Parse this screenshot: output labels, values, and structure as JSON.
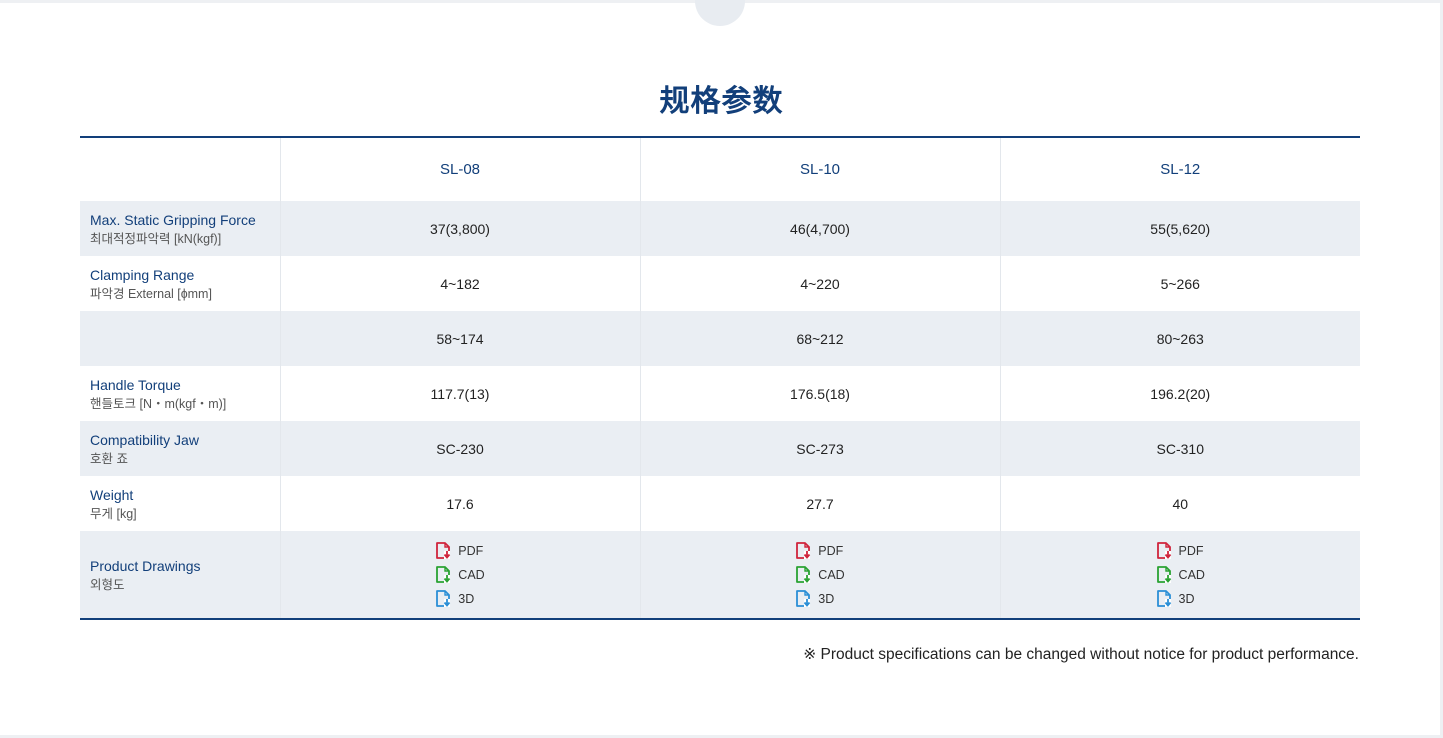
{
  "title": "规格参数",
  "table": {
    "columns": [
      "SL-08",
      "SL-10",
      "SL-12"
    ],
    "rows": [
      {
        "label_en": "Max. Static Gripping Force",
        "label_ko": "최대적정파악력 [kN(kgf)]",
        "values": [
          "37(3,800)",
          "46(4,700)",
          "55(5,620)"
        ]
      },
      {
        "label_en": "Clamping Range",
        "label_ko": "파악경 External [ɸmm]",
        "values": [
          "4~182",
          "4~220",
          "5~266"
        ]
      },
      {
        "label_en": "",
        "label_ko": "",
        "values": [
          "58~174",
          "68~212",
          "80~263"
        ]
      },
      {
        "label_en": "Handle Torque",
        "label_ko": "핸들토크 [N・m(kgf・m)]",
        "values": [
          "117.7(13)",
          "176.5(18)",
          "196.2(20)"
        ]
      },
      {
        "label_en": "Compatibility Jaw",
        "label_ko": "호환 죠",
        "values": [
          "SC-230",
          "SC-273",
          "SC-310"
        ]
      },
      {
        "label_en": "Weight",
        "label_ko": "무게 [kg]",
        "values": [
          "17.6",
          "27.7",
          "40"
        ]
      }
    ],
    "drawings": {
      "label_en": "Product Drawings",
      "label_ko": "외형도",
      "files": [
        {
          "label": "PDF",
          "icon": "pdf-file-icon",
          "color": "#d0243c"
        },
        {
          "label": "CAD",
          "icon": "cad-file-icon",
          "color": "#2aa232"
        },
        {
          "label": "3D",
          "icon": "3d-file-icon",
          "color": "#2b8fd6"
        }
      ]
    }
  },
  "notice": "※ Product specifications can be changed without notice for product performance."
}
